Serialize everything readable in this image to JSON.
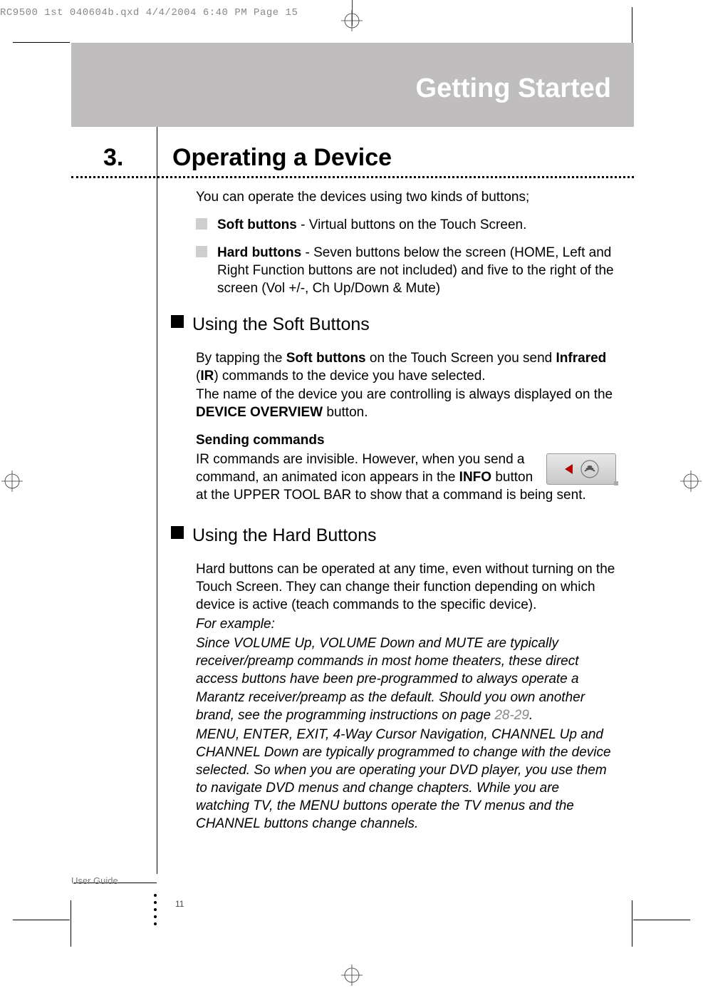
{
  "print_header": "RC9500 1st 040604b.qxd  4/4/2004  6:40 PM  Page 15",
  "banner_title": "Getting Started",
  "section_number": "3.",
  "main_heading": "Operating a Device",
  "intro": "You can operate the devices using two kinds of buttons;",
  "bullets": [
    {
      "bold": "Soft buttons",
      "rest": " - Virtual buttons on the Touch Screen."
    },
    {
      "bold": "Hard buttons",
      "rest": " - Seven buttons below the screen (HOME, Left and Right Function buttons are not included) and five to the right of the screen (Vol +/-, Ch Up/Down & Mute)"
    }
  ],
  "sub1_heading": "Using the Soft Buttons",
  "sub1_p1_a": "By tapping the ",
  "sub1_p1_b": "Soft buttons",
  "sub1_p1_c": " on the Touch Screen you send ",
  "sub1_p1_d": "Infrared",
  "sub1_p1_e": " (",
  "sub1_p1_f": "IR",
  "sub1_p1_g": ") commands to the device you have selected.",
  "sub1_p1_h": "The name of the device you are controlling is always displayed on the ",
  "sub1_p1_i": "DEVICE OVERVIEW",
  "sub1_p1_j": " button.",
  "sending_heading": "Sending commands",
  "sending_a": "IR commands are invisible. However, when you send a command, an animated icon appears in the ",
  "sending_b": "INFO",
  "sending_c": " button at the UPPER TOOL BAR to show that a command is being sent.",
  "sub2_heading": "Using the Hard Buttons",
  "hard_p1": "Hard buttons can be operated at any time, even without turning on the Touch Screen. They can change their function depending on which device is active (teach commands to the specific device).",
  "hard_example_label": "For example:",
  "hard_ex1_a": "Since VOLUME Up, VOLUME Down and MUTE are typically receiver/preamp commands in most home theaters, these direct access buttons have been pre-programmed to always operate a Marantz receiver/preamp as the default. Should you own another brand, see the programming instructions on page ",
  "hard_ex1_pageref": "28-29",
  "hard_ex1_b": ".",
  "hard_ex2": "MENU, ENTER, EXIT, 4-Way Cursor Navigation, CHANNEL Up and CHANNEL Down are typically programmed to change with the device selected. So when you are operating your DVD player, you use them to navigate DVD menus and change chapters. While you are watching TV, the MENU buttons operate the TV menus and the CHANNEL buttons change channels.",
  "user_guide_label": "User Guide",
  "page_number": "11"
}
